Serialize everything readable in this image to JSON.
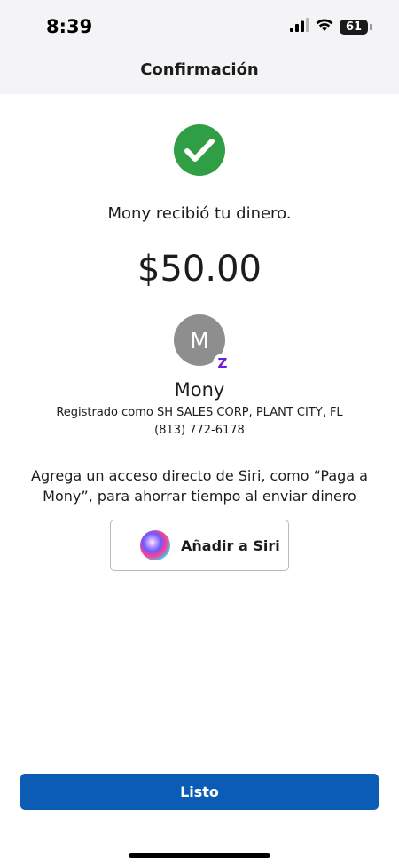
{
  "status_bar": {
    "time": "8:39",
    "battery": "61",
    "battery_level": 0.61
  },
  "nav": {
    "title": "Confirmación"
  },
  "confirmation": {
    "message": "Mony recibió tu dinero.",
    "amount": "$50.00",
    "accent_color": "#2f9e44"
  },
  "recipient": {
    "initial": "M",
    "badge": "Z",
    "name": "Mony",
    "registered": "Registrado como SH SALES CORP, PLANT CITY, FL",
    "phone": "(813) 772-6178"
  },
  "siri": {
    "prompt": "Agrega un acceso directo de Siri, como “Paga a Mony”, para ahorrar tiempo al enviar dinero",
    "button_label": "Añadir a Siri"
  },
  "footer": {
    "done_label": "Listo",
    "button_color": "#0b5cb5"
  }
}
